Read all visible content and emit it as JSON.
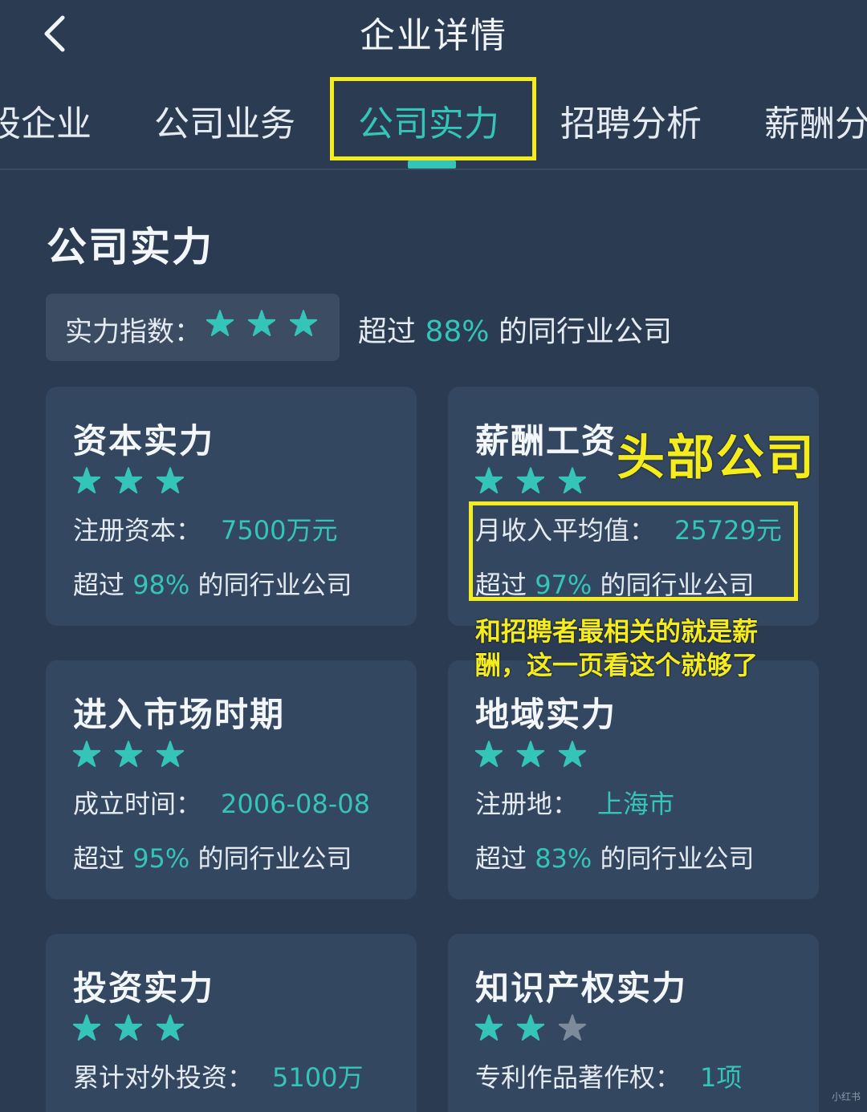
{
  "header": {
    "title": "企业详情"
  },
  "tabs": [
    {
      "label": "股企业"
    },
    {
      "label": "公司业务"
    },
    {
      "label": "公司实力",
      "active": true
    },
    {
      "label": "招聘分析"
    },
    {
      "label": "薪酬分"
    }
  ],
  "section_title": "公司实力",
  "index": {
    "label": "实力指数：",
    "stars_filled": 3,
    "stars_total": 3,
    "desc_prefix": "超过",
    "desc_value": "88%",
    "desc_suffix": "的同行业公司"
  },
  "cards": [
    {
      "title": "资本实力",
      "stars_filled": 3,
      "stars_total": 3,
      "field_label": "注册资本：",
      "field_value": "7500万元",
      "pct_prefix": "超过",
      "pct_value": "98%",
      "pct_suffix": "的同行业公司"
    },
    {
      "title": "薪酬工资",
      "stars_filled": 3,
      "stars_total": 3,
      "field_label": "月收入平均值：",
      "field_value": "25729元",
      "pct_prefix": "超过",
      "pct_value": "97%",
      "pct_suffix": "的同行业公司"
    },
    {
      "title": "进入市场时期",
      "stars_filled": 3,
      "stars_total": 3,
      "field_label": "成立时间：",
      "field_value": "2006-08-08",
      "pct_prefix": "超过",
      "pct_value": "95%",
      "pct_suffix": "的同行业公司"
    },
    {
      "title": "地域实力",
      "stars_filled": 3,
      "stars_total": 3,
      "field_label": "注册地：",
      "field_value": "上海市",
      "pct_prefix": "超过",
      "pct_value": "83%",
      "pct_suffix": "的同行业公司"
    },
    {
      "title": "投资实力",
      "stars_filled": 3,
      "stars_total": 3,
      "field_label": "累计对外投资：",
      "field_value": "5100万"
    },
    {
      "title": "知识产权实力",
      "stars_filled": 2,
      "stars_total": 3,
      "field_label": "专利作品著作权：",
      "field_value": "1项"
    }
  ],
  "annotations": {
    "headline": "头部公司",
    "note": "和招聘者最相关的就是薪酬，这一页看这个就够了"
  },
  "watermark": "小红书",
  "colors": {
    "accent": "#35c4b8",
    "highlight": "#f5ec1e",
    "star_empty": "#7d8a9a",
    "background": "#2b3c52",
    "card": "#334760"
  },
  "icons": {
    "back": "chevron-left-icon",
    "star": "star-icon"
  }
}
